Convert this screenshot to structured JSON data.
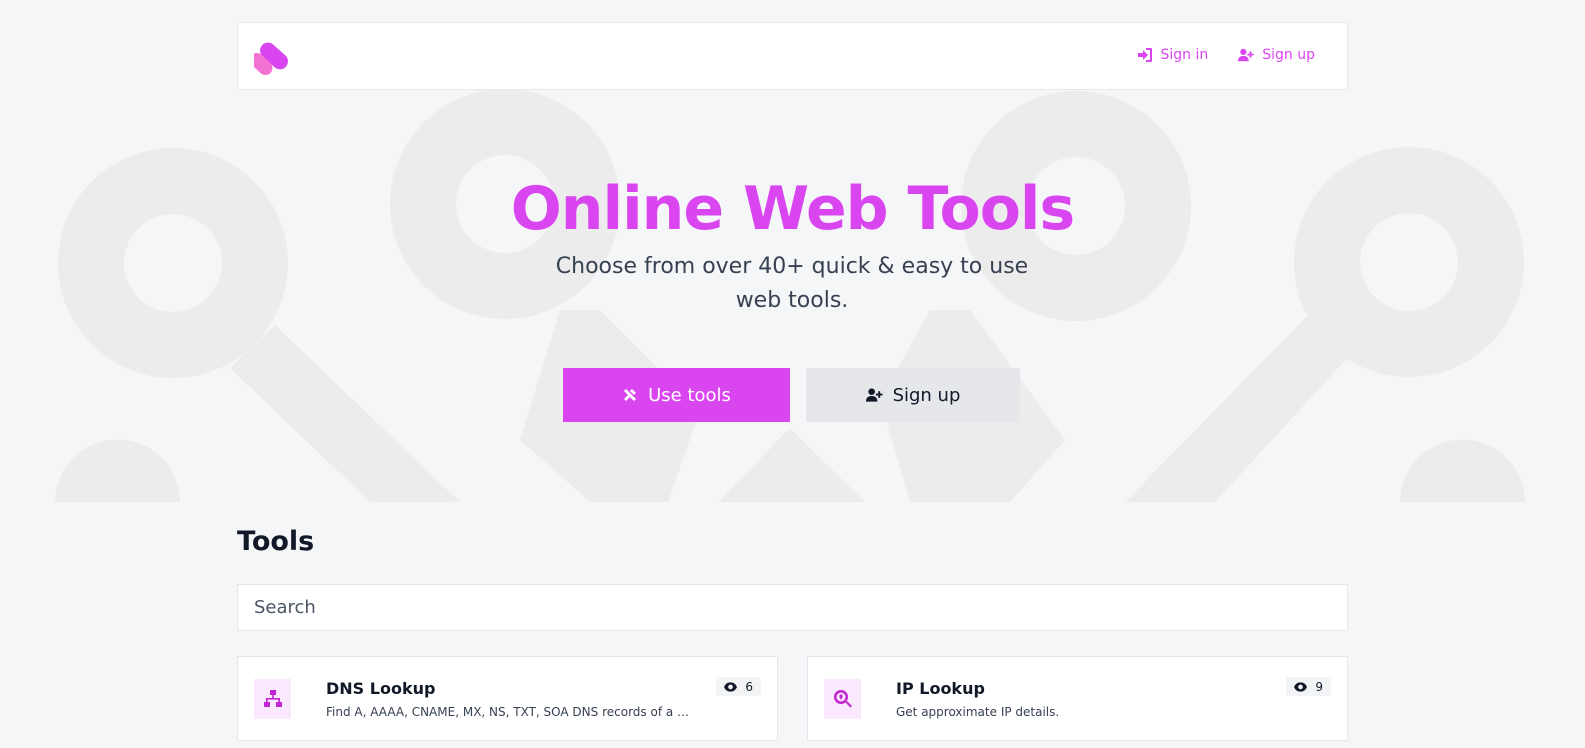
{
  "nav": {
    "sign_in_label": "Sign in",
    "sign_up_label": "Sign up"
  },
  "hero": {
    "title": "Online Web Tools",
    "subtitle": "Choose from over 40+ quick & easy to use web tools.",
    "primary_button_label": "Use tools",
    "secondary_button_label": "Sign up"
  },
  "tools": {
    "heading": "Tools",
    "search_placeholder": "Search",
    "cards": [
      {
        "title": "DNS Lookup",
        "description": "Find A, AAAA, CNAME, MX, NS, TXT, SOA DNS records of a host.",
        "views": "6",
        "icon": "network-icon"
      },
      {
        "title": "IP Lookup",
        "description": "Get approximate IP details.",
        "views": "9",
        "icon": "search-location-icon"
      }
    ]
  },
  "colors": {
    "accent": "#d946ef",
    "secondary_button": "#e5e7eb",
    "background": "#f5f6f8"
  }
}
